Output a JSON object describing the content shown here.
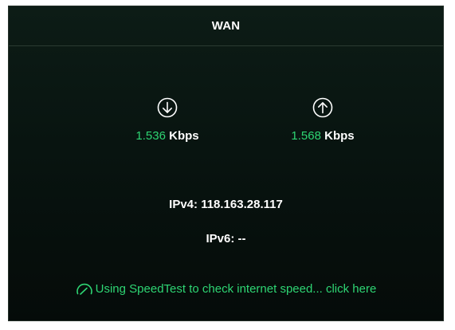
{
  "panel": {
    "title": "WAN"
  },
  "download": {
    "icon": "arrow-down-circle-icon",
    "value": "1.536",
    "unit": "Kbps"
  },
  "upload": {
    "icon": "arrow-up-circle-icon",
    "value": "1.568",
    "unit": "Kbps"
  },
  "ip": {
    "ipv4_label": "IPv4:",
    "ipv4_value": "118.163.28.117",
    "ipv6_label": "IPv6:",
    "ipv6_value": "--"
  },
  "speedtest": {
    "icon": "speedometer-icon",
    "link_text": "Using SpeedTest to check internet speed... click here"
  },
  "colors": {
    "accent_green": "#2ed573",
    "text_white": "#ffffff",
    "panel_bg": "#0a1712"
  }
}
